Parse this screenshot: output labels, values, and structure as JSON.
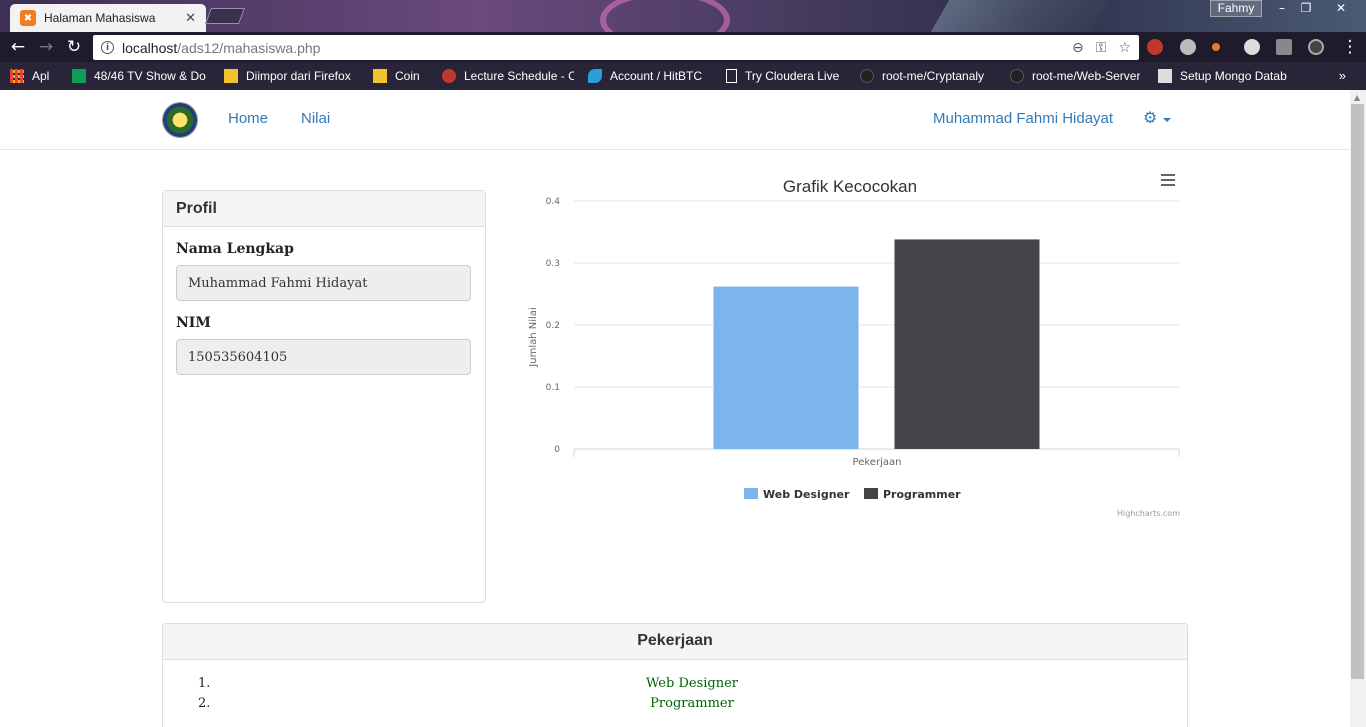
{
  "browser": {
    "tab_title": "Halaman Mahasiswa",
    "profile_name": "Fahmy",
    "url_host": "localhost",
    "url_path": "/ads12/mahasiswa.php",
    "bookmarks": [
      {
        "label": "Apl",
        "icon": "apps-grid-icon",
        "color": "#e8453c"
      },
      {
        "label": "48/46 TV Show & Do",
        "icon": "sheets-icon",
        "color": "#0f9d58"
      },
      {
        "label": "Diimpor dari Firefox",
        "icon": "folder-icon",
        "color": "#f4c430"
      },
      {
        "label": "Coin",
        "icon": "folder-icon",
        "color": "#f4c430"
      },
      {
        "label": "Lecture Schedule - C",
        "icon": "apple-icon",
        "color": "#c0392b"
      },
      {
        "label": "Account / HitBTC",
        "icon": "fish-icon",
        "color": "#2a9fd6"
      },
      {
        "label": "Try Cloudera Live",
        "icon": "page-icon",
        "color": "#ffffff"
      },
      {
        "label": "root-me/Cryptanaly",
        "icon": "github-icon",
        "color": "#222222"
      },
      {
        "label": "root-me/Web-Server",
        "icon": "github-icon",
        "color": "#222222"
      },
      {
        "label": "Setup Mongo Datab",
        "icon": "page-icon",
        "color": "#dddddd"
      }
    ]
  },
  "navbar": {
    "home": "Home",
    "nilai": "Nilai",
    "user": "Muhammad Fahmi Hidayat"
  },
  "profil": {
    "title": "Profil",
    "nama_label": "Nama Lengkap",
    "nama_value": "Muhammad Fahmi Hidayat",
    "nim_label": "NIM",
    "nim_value": "150535604105"
  },
  "chart_data": {
    "type": "bar",
    "title": "Grafik Kecocokan",
    "xlabel": "",
    "ylabel": "Jumlah Nilai",
    "categories": [
      "Pekerjaan"
    ],
    "ylim": [
      0,
      0.4
    ],
    "yticks": [
      "0",
      "0.1",
      "0.2",
      "0.3",
      "0.4"
    ],
    "series": [
      {
        "name": "Web Designer",
        "values": [
          0.262
        ],
        "color": "#7cb5ec"
      },
      {
        "name": "Programmer",
        "values": [
          0.338
        ],
        "color": "#434348"
      }
    ],
    "legend": "bottom-center",
    "credits": "Highcharts.com",
    "grid": true
  },
  "pekerjaan": {
    "title": "Pekerjaan",
    "items": [
      {
        "num": "1.",
        "label": "Web Designer"
      },
      {
        "num": "2.",
        "label": "Programmer"
      }
    ]
  }
}
